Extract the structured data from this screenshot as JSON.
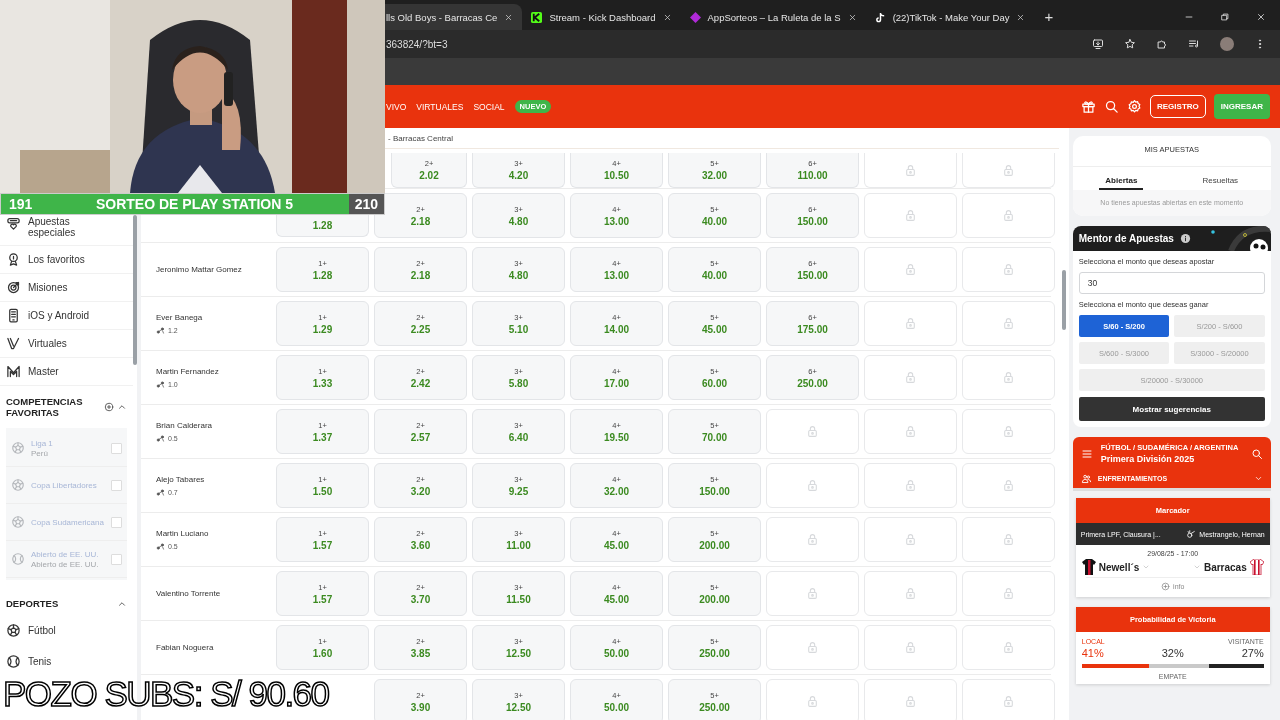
{
  "browser": {
    "tabs": [
      {
        "title": "lls Old Boys - Barracas Ce",
        "selected": true
      },
      {
        "title": "Stream - Kick Dashboard",
        "selected": false
      },
      {
        "title": "AppSorteos – La Ruleta de la S",
        "selected": false
      },
      {
        "title": "(22)TikTok - Make Your Day",
        "selected": false
      }
    ],
    "new_tab": "+",
    "address": "363824/?bt=3"
  },
  "stream_overlay": {
    "left_count": "191",
    "title": "SORTEO DE PLAY STATION 5",
    "right_count": "210",
    "caption": "POZO SUBS: S/ 90.60"
  },
  "header": {
    "nav": [
      {
        "label": "VIVO"
      },
      {
        "label": "VIRTUALES"
      },
      {
        "label": "SOCIAL",
        "badge": "NUEVO"
      }
    ],
    "register": "REGISTRO",
    "login": "INGRESAR"
  },
  "sidebar": {
    "items": [
      "Apuestas especiales",
      "Los favoritos",
      "Misiones",
      "iOS y Android",
      "Virtuales",
      "Master"
    ],
    "favorites": {
      "title": "COMPETENCIAS FAVORITAS",
      "items": [
        {
          "name": "Liga 1",
          "sub": "Perú",
          "checked": false
        },
        {
          "name": "Copa Libertadores",
          "checked": false
        },
        {
          "name": "Copa Sudamericana",
          "checked": false
        },
        {
          "name": "Abierto de EE. UU.",
          "sub": "Abierto de EE. UU.",
          "checked": false
        }
      ]
    },
    "sports": {
      "title": "DEPORTES",
      "items": [
        "Fútbol",
        "Tenis"
      ]
    }
  },
  "market": {
    "breadcrumb": "- Barracas Central",
    "rows": [
      {
        "cells": [
          "",
          {
            "kind": "odds",
            "label": "2+",
            "odds": "2.02"
          },
          {
            "kind": "odds",
            "label": "3+",
            "odds": "4.20"
          },
          {
            "kind": "odds",
            "label": "4+",
            "odds": "10.50"
          },
          {
            "kind": "odds",
            "label": "5+",
            "odds": "32.00"
          },
          {
            "kind": "odds",
            "label": "6+",
            "odds": "110.00"
          },
          {
            "kind": "locked"
          },
          {
            "kind": "locked"
          }
        ]
      },
      {
        "cells": [
          {
            "kind": "odds",
            "odds": "1.28"
          },
          {
            "kind": "odds",
            "label": "2+",
            "odds": "2.18"
          },
          {
            "kind": "odds",
            "label": "3+",
            "odds": "4.80"
          },
          {
            "kind": "odds",
            "label": "4+",
            "odds": "13.00"
          },
          {
            "kind": "odds",
            "label": "5+",
            "odds": "40.00"
          },
          {
            "kind": "odds",
            "label": "6+",
            "odds": "150.00"
          },
          {
            "kind": "locked"
          },
          {
            "kind": "locked"
          }
        ]
      },
      {
        "name": "Jeronimo Mattar Gomez",
        "cells": [
          {
            "kind": "odds",
            "label": "1+",
            "odds": "1.28"
          },
          {
            "kind": "odds",
            "label": "2+",
            "odds": "2.18"
          },
          {
            "kind": "odds",
            "label": "3+",
            "odds": "4.80"
          },
          {
            "kind": "odds",
            "label": "4+",
            "odds": "13.00"
          },
          {
            "kind": "odds",
            "label": "5+",
            "odds": "40.00"
          },
          {
            "kind": "odds",
            "label": "6+",
            "odds": "150.00"
          },
          {
            "kind": "locked"
          },
          {
            "kind": "locked"
          }
        ]
      },
      {
        "name": "Ever Banega",
        "rating": "1.2",
        "cells": [
          {
            "kind": "odds",
            "label": "1+",
            "odds": "1.29"
          },
          {
            "kind": "odds",
            "label": "2+",
            "odds": "2.25"
          },
          {
            "kind": "odds",
            "label": "3+",
            "odds": "5.10"
          },
          {
            "kind": "odds",
            "label": "4+",
            "odds": "14.00"
          },
          {
            "kind": "odds",
            "label": "5+",
            "odds": "45.00"
          },
          {
            "kind": "odds",
            "label": "6+",
            "odds": "175.00"
          },
          {
            "kind": "locked"
          },
          {
            "kind": "locked"
          }
        ]
      },
      {
        "name": "Martin Fernandez",
        "rating": "1.0",
        "cells": [
          {
            "kind": "odds",
            "label": "1+",
            "odds": "1.33"
          },
          {
            "kind": "odds",
            "label": "2+",
            "odds": "2.42"
          },
          {
            "kind": "odds",
            "label": "3+",
            "odds": "5.80"
          },
          {
            "kind": "odds",
            "label": "4+",
            "odds": "17.00"
          },
          {
            "kind": "odds",
            "label": "5+",
            "odds": "60.00"
          },
          {
            "kind": "odds",
            "label": "6+",
            "odds": "250.00"
          },
          {
            "kind": "locked"
          },
          {
            "kind": "locked"
          }
        ]
      },
      {
        "name": "Brian Calderara",
        "rating": "0.5",
        "cells": [
          {
            "kind": "odds",
            "label": "1+",
            "odds": "1.37"
          },
          {
            "kind": "odds",
            "label": "2+",
            "odds": "2.57"
          },
          {
            "kind": "odds",
            "label": "3+",
            "odds": "6.40"
          },
          {
            "kind": "odds",
            "label": "4+",
            "odds": "19.50"
          },
          {
            "kind": "odds",
            "label": "5+",
            "odds": "70.00"
          },
          {
            "kind": "locked"
          },
          {
            "kind": "locked"
          },
          {
            "kind": "locked"
          }
        ]
      },
      {
        "name": "Alejo Tabares",
        "rating": "0.7",
        "cells": [
          {
            "kind": "odds",
            "label": "1+",
            "odds": "1.50"
          },
          {
            "kind": "odds",
            "label": "2+",
            "odds": "3.20"
          },
          {
            "kind": "odds",
            "label": "3+",
            "odds": "9.25"
          },
          {
            "kind": "odds",
            "label": "4+",
            "odds": "32.00"
          },
          {
            "kind": "odds",
            "label": "5+",
            "odds": "150.00"
          },
          {
            "kind": "locked"
          },
          {
            "kind": "locked"
          },
          {
            "kind": "locked"
          }
        ]
      },
      {
        "name": "Martin Luciano",
        "rating": "0.5",
        "cells": [
          {
            "kind": "odds",
            "label": "1+",
            "odds": "1.57"
          },
          {
            "kind": "odds",
            "label": "2+",
            "odds": "3.60"
          },
          {
            "kind": "odds",
            "label": "3+",
            "odds": "11.00"
          },
          {
            "kind": "odds",
            "label": "4+",
            "odds": "45.00"
          },
          {
            "kind": "odds",
            "label": "5+",
            "odds": "200.00"
          },
          {
            "kind": "locked"
          },
          {
            "kind": "locked"
          },
          {
            "kind": "locked"
          }
        ]
      },
      {
        "name": "Valentino Torrente",
        "cells": [
          {
            "kind": "odds",
            "label": "1+",
            "odds": "1.57"
          },
          {
            "kind": "odds",
            "label": "2+",
            "odds": "3.70"
          },
          {
            "kind": "odds",
            "label": "3+",
            "odds": "11.50"
          },
          {
            "kind": "odds",
            "label": "4+",
            "odds": "45.00"
          },
          {
            "kind": "odds",
            "label": "5+",
            "odds": "200.00"
          },
          {
            "kind": "locked"
          },
          {
            "kind": "locked"
          },
          {
            "kind": "locked"
          }
        ]
      },
      {
        "name": "Fabian Noguera",
        "cells": [
          {
            "kind": "odds",
            "label": "1+",
            "odds": "1.60"
          },
          {
            "kind": "odds",
            "label": "2+",
            "odds": "3.85"
          },
          {
            "kind": "odds",
            "label": "3+",
            "odds": "12.50"
          },
          {
            "kind": "odds",
            "label": "4+",
            "odds": "50.00"
          },
          {
            "kind": "odds",
            "label": "5+",
            "odds": "250.00"
          },
          {
            "kind": "locked"
          },
          {
            "kind": "locked"
          },
          {
            "kind": "locked"
          }
        ]
      },
      {
        "cells": [
          "",
          {
            "kind": "odds",
            "label": "2+",
            "odds": "3.90"
          },
          {
            "kind": "odds",
            "label": "3+",
            "odds": "12.50"
          },
          {
            "kind": "odds",
            "label": "4+",
            "odds": "50.00"
          },
          {
            "kind": "odds",
            "label": "5+",
            "odds": "250.00"
          },
          {
            "kind": "locked"
          },
          {
            "kind": "locked"
          },
          {
            "kind": "locked"
          }
        ]
      }
    ]
  },
  "bet_slip": {
    "title": "MIS APUESTAS",
    "tabs": [
      {
        "label": "Abiertas",
        "selected": true
      },
      {
        "label": "Resueltas",
        "selected": false
      }
    ],
    "message": "No tienes apuestas abiertas en este momento"
  },
  "mentor": {
    "title": "Mentor de Apuestas",
    "stake_label": "Selecciona el monto que deseas apostar",
    "stake": "30",
    "win_label": "Selecciona el monto que deseas ganar",
    "options": [
      {
        "label": "S/60 - S/200",
        "selected": true
      },
      {
        "label": "S/200 - S/600",
        "selected": false
      },
      {
        "label": "S/600 - S/3000",
        "selected": false
      },
      {
        "label": "S/3000 - S/20000",
        "selected": false
      },
      {
        "label": "S/20000 - S/30000",
        "selected": false
      }
    ],
    "button": "Mostrar sugerencias"
  },
  "league": {
    "path": "FÚTBOL / SUDAMÉRICA / ARGENTINA",
    "title": "Primera División 2025",
    "section": "ENFRENTAMIENTOS"
  },
  "scoreboard": {
    "title": "Marcador",
    "competition": "Primera LPF, Clausura |...",
    "referee": "Mestrangelo, Hernan",
    "date": "29/08/25 - 17:00",
    "home": "Newell´s",
    "away": "Barracas",
    "info": "info"
  },
  "win_probability": {
    "title": "Probabilidad de Victoria",
    "outcomes": [
      {
        "label": "LOCAL",
        "value": "41%"
      },
      {
        "label": "EMPATE",
        "value": "32%"
      },
      {
        "label": "VISITANTE",
        "value": "27%"
      }
    ]
  }
}
